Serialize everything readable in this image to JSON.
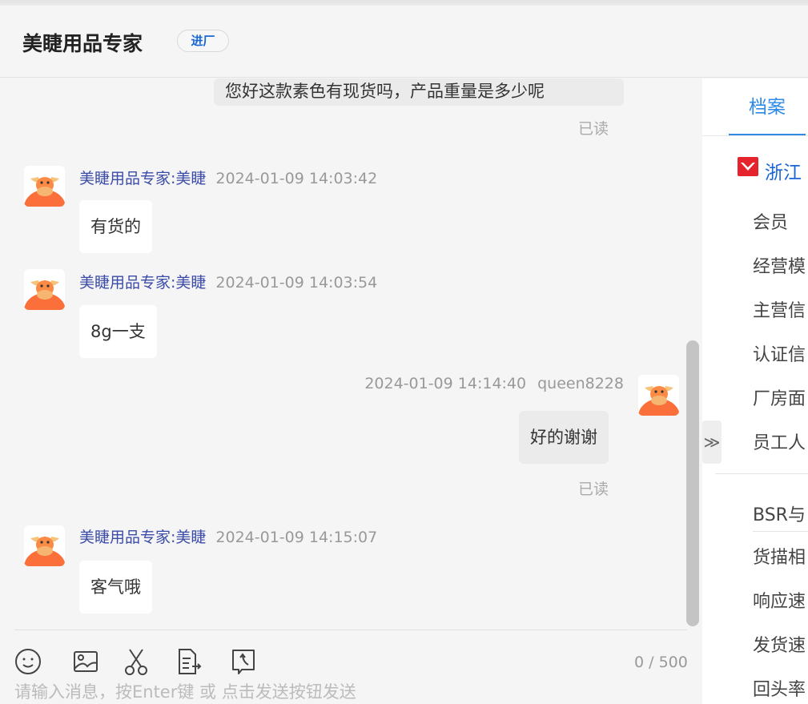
{
  "header": {
    "title": "美睫用品专家",
    "badge": "进厂"
  },
  "messages": [
    {
      "type": "me",
      "text": "您好这款素色有现货吗，产品重量是多少呢",
      "read": "已读"
    },
    {
      "type": "other",
      "sender": "美睫用品专家:美睫",
      "time": "2024-01-09 14:03:42",
      "text": "有货的"
    },
    {
      "type": "other",
      "sender": "美睫用品专家:美睫",
      "time": "2024-01-09 14:03:54",
      "text": "8g一支"
    },
    {
      "type": "me",
      "sender": "queen8228",
      "time": "2024-01-09 14:14:40",
      "text": "好的谢谢",
      "read": "已读"
    },
    {
      "type": "other",
      "sender": "美睫用品专家:美睫",
      "time": "2024-01-09 14:15:07",
      "text": "客气哦"
    }
  ],
  "input": {
    "counter": "0 / 500",
    "placeholder": "请输入消息，按Enter键 或 点击发送按钮发送"
  },
  "panel": {
    "tab": "档案",
    "company": "浙江",
    "collapse": "≫",
    "items": [
      "会员",
      "经营模",
      "主营信",
      "认证信",
      "厂房面",
      "员工人",
      "BSR与",
      "货描相",
      "响应速",
      "发货速",
      "回头率"
    ]
  },
  "colors": {
    "accent": "#2e8ae6",
    "sender": "#3b4ba8",
    "brand_red": "#e4232d"
  }
}
